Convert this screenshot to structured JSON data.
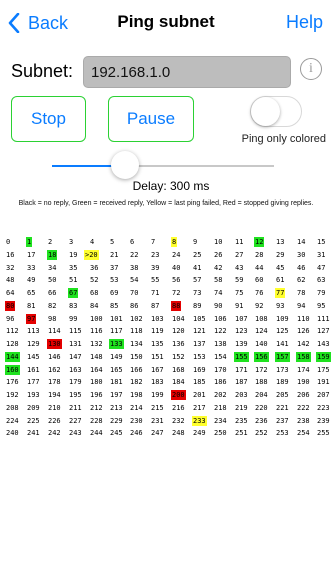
{
  "nav": {
    "back_label": "Back",
    "title": "Ping subnet",
    "help_label": "Help"
  },
  "subnet": {
    "label": "Subnet:",
    "value": "192.168.1.0"
  },
  "controls": {
    "stop_label": "Stop",
    "pause_label": "Pause",
    "toggle_label": "Ping only colored",
    "toggle_on": false
  },
  "delay": {
    "label": "Delay: 300 ms",
    "slider_fraction": 0.33
  },
  "legend": "Black = no reply, Green = received reply, Yellow = last ping failed, Red = stopped giving replies.",
  "status_colors": {
    "green": "#1fe21f",
    "yellow": "#ffff2e",
    "red": "#e40000"
  },
  "hosts": {
    "columns": 16,
    "current": 20,
    "current_prefix": ">",
    "green": [
      1,
      12,
      18,
      67,
      133,
      144,
      155,
      156,
      157,
      158,
      159,
      160
    ],
    "yellow": [
      8,
      20,
      77,
      233
    ],
    "red": [
      80,
      88,
      97,
      130,
      200
    ]
  }
}
